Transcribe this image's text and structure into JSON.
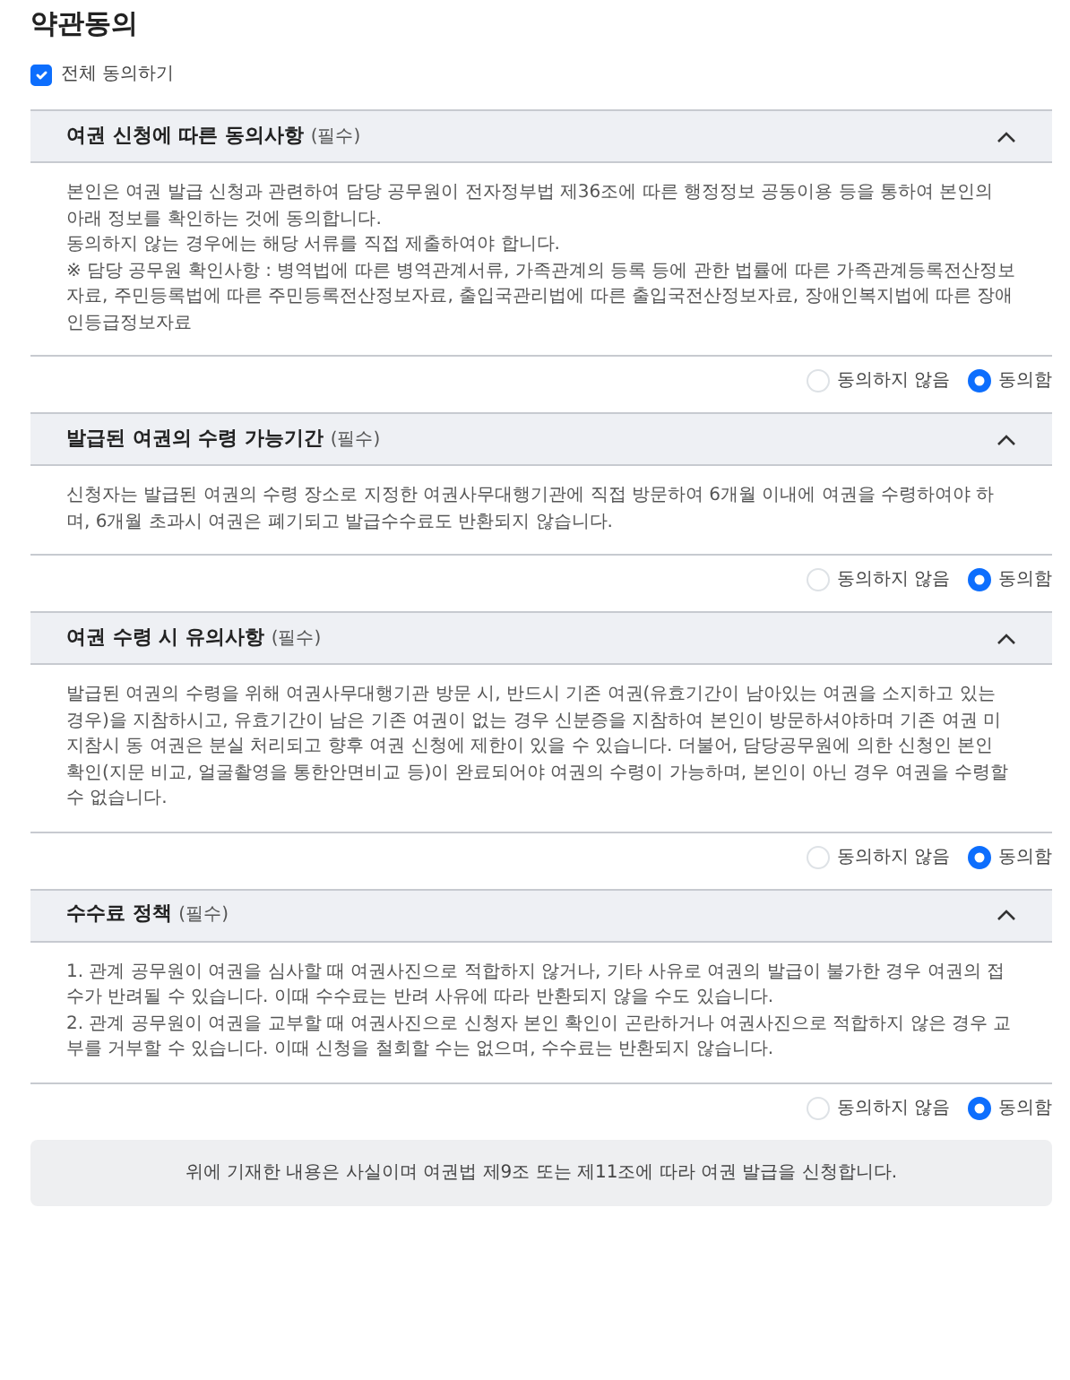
{
  "title": "약관동의",
  "agree_all": {
    "label": "전체 동의하기",
    "checked": true
  },
  "sections": [
    {
      "title": "여권 신청에 따른 동의사항",
      "required": "(필수)",
      "expanded": true,
      "paragraphs": [
        "본인은 여권 발급 신청과 관련하여 담당 공무원이 전자정부법 제36조에 따른 행정정보 공동이용 등을 통하여 본인의 아래 정보를 확인하는 것에 동의합니다.",
        "동의하지 않는 경우에는 해당 서류를 직접 제출하여야 합니다.",
        "※ 담당 공무원 확인사항 : 병역법에 따른 병역관계서류, 가족관계의 등록 등에 관한 법률에 따른 가족관계등록전산정보자료, 주민등록법에 따른 주민등록전산정보자료, 출입국관리법에 따른 출입국전산정보자료, 장애인복지법에 따른 장애인등급정보자료"
      ],
      "options": [
        {
          "label": "동의하지 않음",
          "selected": false
        },
        {
          "label": "동의함",
          "selected": true
        }
      ]
    },
    {
      "title": "발급된 여권의 수령 가능기간",
      "required": "(필수)",
      "expanded": true,
      "paragraphs": [
        "신청자는 발급된 여권의 수령 장소로 지정한 여권사무대행기관에 직접 방문하여 6개월 이내에 여권을 수령하여야 하며, 6개월 초과시 여권은 폐기되고 발급수수료도 반환되지 않습니다."
      ],
      "options": [
        {
          "label": "동의하지 않음",
          "selected": false
        },
        {
          "label": "동의함",
          "selected": true
        }
      ]
    },
    {
      "title": "여권 수령 시 유의사항",
      "required": "(필수)",
      "expanded": true,
      "paragraphs": [
        "발급된 여권의 수령을 위해 여권사무대행기관 방문 시, 반드시 기존 여권(유효기간이 남아있는 여권을 소지하고 있는 경우)을 지참하시고, 유효기간이 남은 기존 여권이 없는 경우 신분증을 지참하여 본인이 방문하셔야하며 기존 여권 미지참시 동 여권은 분실 처리되고 향후 여권 신청에 제한이 있을 수 있습니다. 더불어, 담당공무원에 의한 신청인 본인 확인(지문 비교, 얼굴촬영을 통한안면비교 등)이 완료되어야 여권의 수령이 가능하며, 본인이 아닌 경우 여권을 수령할 수 없습니다."
      ],
      "options": [
        {
          "label": "동의하지 않음",
          "selected": false
        },
        {
          "label": "동의함",
          "selected": true
        }
      ]
    },
    {
      "title": "수수료 정책",
      "required": "(필수)",
      "expanded": true,
      "paragraphs": [
        "1. 관계 공무원이 여권을 심사할 때 여권사진으로 적합하지 않거나, 기타 사유로 여권의 발급이 불가한 경우 여권의 접수가 반려될 수 있습니다. 이때 수수료는 반려 사유에 따라 반환되지 않을 수도 있습니다.",
        "2. 관계 공무원이 여권을 교부할 때 여권사진으로 신청자 본인 확인이 곤란하거나 여권사진으로 적합하지 않은 경우 교부를 거부할 수 있습니다. 이때 신청을 철회할 수는 없으며, 수수료는 반환되지 않습니다."
      ],
      "options": [
        {
          "label": "동의하지 않음",
          "selected": false
        },
        {
          "label": "동의함",
          "selected": true
        }
      ]
    }
  ],
  "notice": "위에 기재한 내용은 사실이며 여권법 제9조 또는 제11조에 따라 여권 발급을 신청합니다."
}
